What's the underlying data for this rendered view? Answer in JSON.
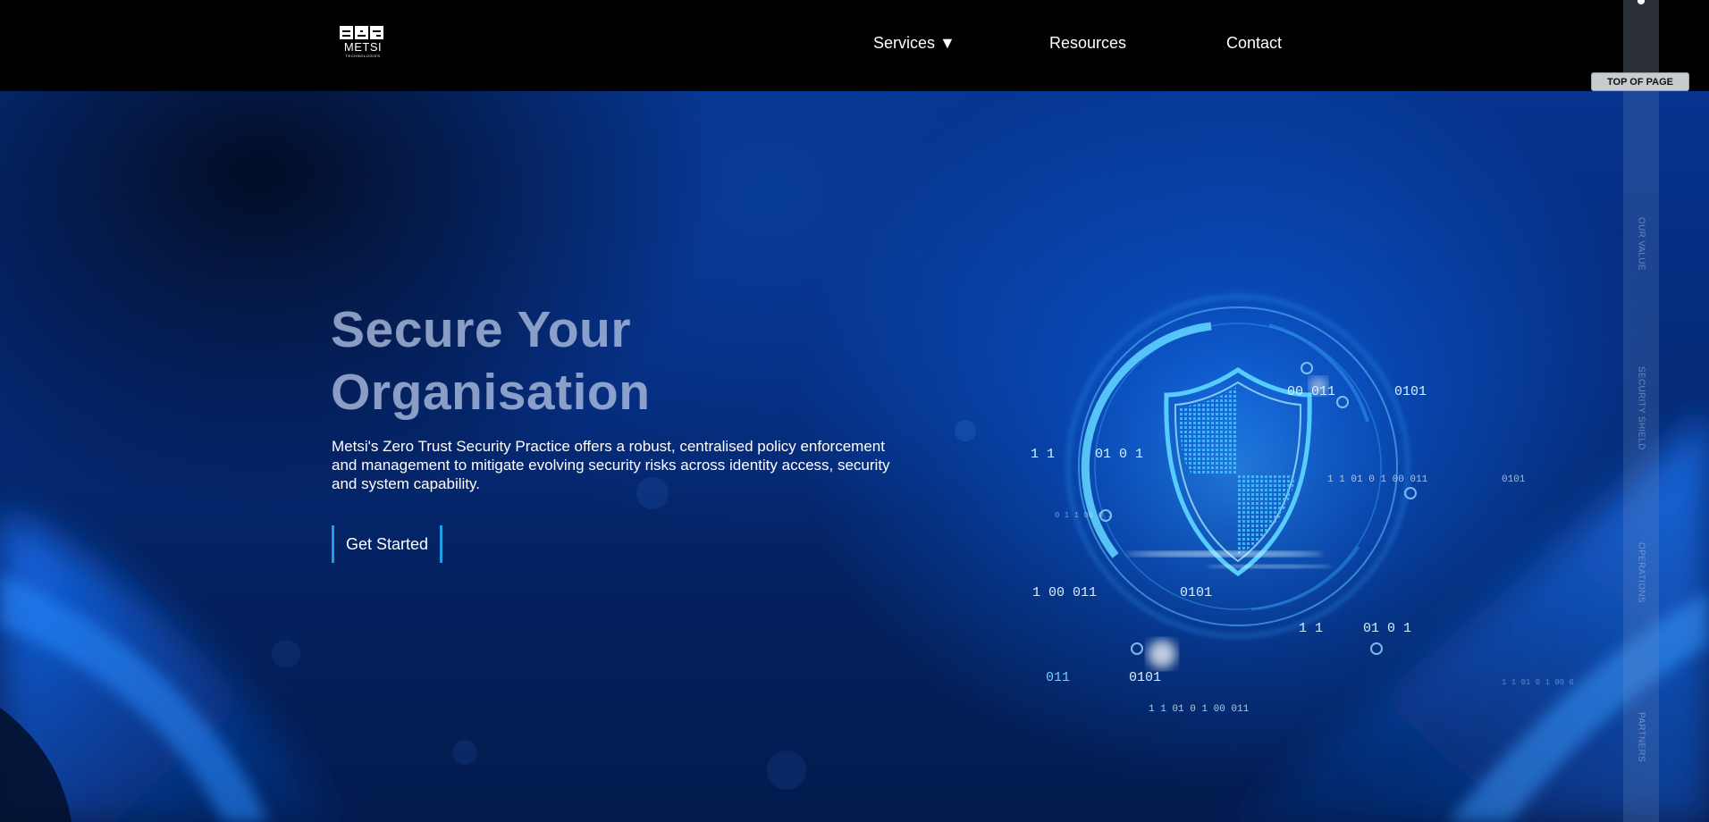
{
  "header": {
    "logo": {
      "word": "METSI",
      "sub": "TECHNOLOGIES"
    },
    "nav": [
      {
        "label": "Services ▼"
      },
      {
        "label": "Resources"
      },
      {
        "label": "Contact"
      }
    ]
  },
  "hero": {
    "title_line1": "Secure Your",
    "title_line2": "Organisation",
    "description": "Metsi's Zero Trust Security Practice offers a robust, centralised policy enforcement and management to mitigate evolving security risks across identity access, security and system capability.",
    "cta_label": "Get Started"
  },
  "side_nav": {
    "top_button": "TOP OF PAGE",
    "items": [
      {
        "label": "Our Value"
      },
      {
        "label": "Security Shield"
      },
      {
        "label": "Operations"
      },
      {
        "label": "Partners"
      }
    ]
  },
  "colors": {
    "accent": "#1aa0e6",
    "hero_blue": "#0a57d0",
    "header_bg": "#000000"
  }
}
